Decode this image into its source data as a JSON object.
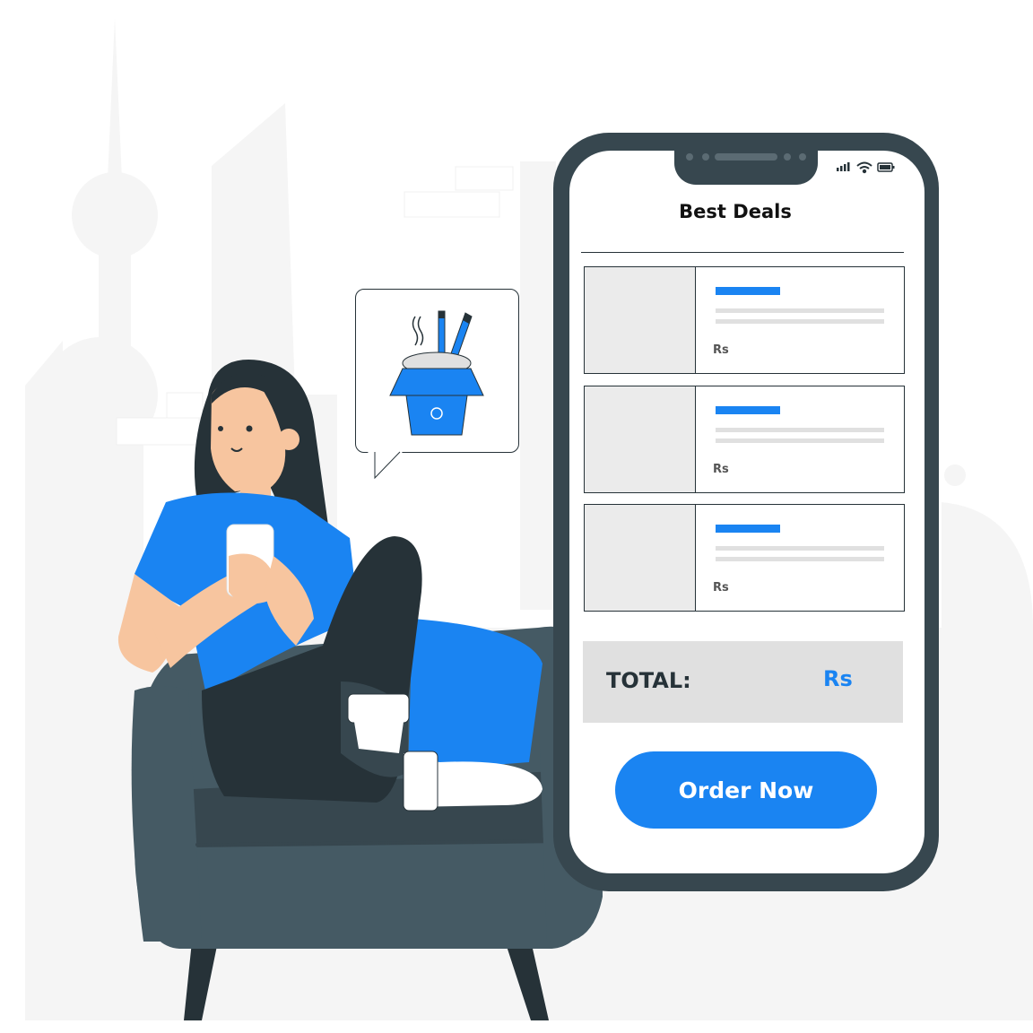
{
  "app": {
    "title": "Best Deals"
  },
  "deals": [
    {
      "price_label": "Rs"
    },
    {
      "price_label": "Rs"
    },
    {
      "price_label": "Rs"
    }
  ],
  "summary": {
    "total_label": "TOTAL:",
    "total_value": "Rs"
  },
  "actions": {
    "order_label": "Order Now"
  },
  "icons": {
    "status": [
      "cellular-signal-icon",
      "wifi-icon",
      "battery-icon"
    ],
    "bubble": "noodle-box-icon"
  },
  "colors": {
    "accent": "#1a84f2",
    "phone_frame": "#37474f",
    "background_silhouettes": "#f5f5f5",
    "panel_gray": "#e0e0e0"
  }
}
